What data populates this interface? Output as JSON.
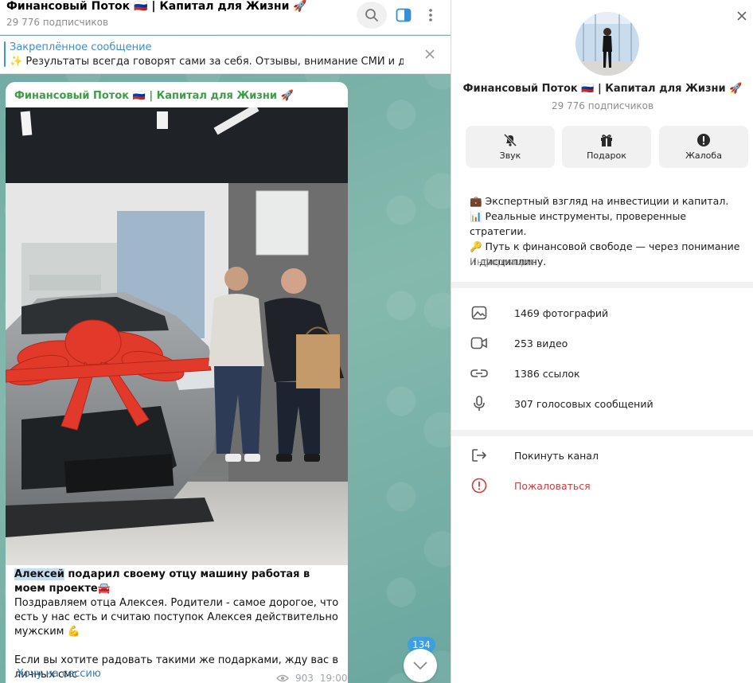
{
  "chat": {
    "title": "Финансовый Поток 🇷🇺 | Капитал для Жизни 🚀",
    "subscribers": "29 776 подписчиков",
    "pinned_title": "Закреплённое сообщение",
    "pinned_text": "✨ Результаты всегда говорят сами за себя. Отзывы, внимание СМИ и довер...",
    "message": {
      "author": "Финансовый Поток 🇷🇺 | Капитал для Жизни 🚀",
      "caption_highlight": "Алексей",
      "caption_bold_rest": " подарил своему отцу машину работая в моем проекте🚘",
      "caption_p2": "Поздравляем отца Алексея. Родители - самое дорогое, что есть у нас есть и считаю поступок Алексея действительно мужским 💪",
      "caption_p3": "Если вы хотите радовать такими же подарками, жду вас в личных смс",
      "link": "Хочу на сессию",
      "views": "903",
      "time": "19:00"
    },
    "unread_count": "134"
  },
  "info": {
    "name": "Финансовый Поток 🇷🇺 | Капитал для Жизни 🚀",
    "subscribers": "29 776 подписчиков",
    "actions": [
      {
        "label": "Звук",
        "icon": "bell-off-icon"
      },
      {
        "label": "Подарок",
        "icon": "gift-icon"
      },
      {
        "label": "Жалоба",
        "icon": "warning-icon"
      }
    ],
    "about_lines": [
      "💼 Экспертный взгляд на инвестиции и капитал.",
      "📊 Реальные инструменты, проверенные стратегии.",
      "🔑 Путь к финансовой свободе — через понимание и дисциплину."
    ],
    "about_label": "Информация",
    "media": [
      {
        "label": "1469 фотографий",
        "icon": "photo-icon"
      },
      {
        "label": "253 видео",
        "icon": "video-icon"
      },
      {
        "label": "1386 ссылок",
        "icon": "link-icon"
      },
      {
        "label": "307 голосовых сообщений",
        "icon": "microphone-icon"
      }
    ],
    "leave": "Покинуть канал",
    "report": "Пожаловаться"
  },
  "colors": {
    "accent": "#3a8fd0",
    "author_green": "#3d9e47",
    "danger": "#d33a3a",
    "chat_bg": "#78b1a6"
  }
}
